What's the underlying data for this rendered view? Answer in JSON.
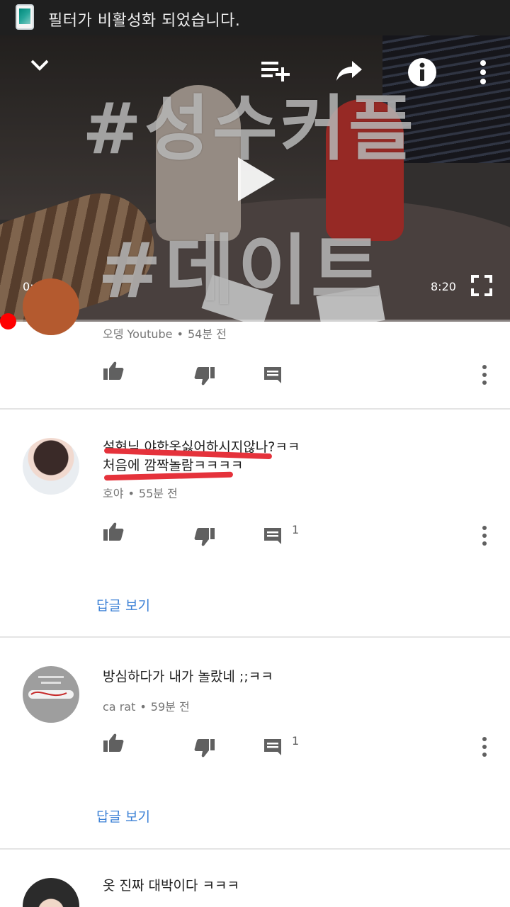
{
  "status_bar": {
    "app_icon": "phone-app-icon",
    "notification_text": "필터가 비활성화 되었습니다."
  },
  "player": {
    "overlay_title_line1": "#성수커플",
    "overlay_title_line2": "#데이트",
    "current_time": "0:04",
    "duration": "8:20",
    "progress_fraction": 0.008,
    "icons": [
      "chevron-down-icon",
      "add-to-playlist-icon",
      "share-icon",
      "info-icon",
      "more-vert-icon",
      "play-icon",
      "fullscreen-icon"
    ]
  },
  "comments": [
    {
      "author": "오뎅 Youtube",
      "time": "54분 전",
      "text": "",
      "reply_count": "",
      "view_replies": ""
    },
    {
      "author": "호야",
      "time": "55분 전",
      "text_line1": "설현님 야한옷싫어하시지않나?ㅋㅋ",
      "text_line2": "처음에 깜짝놀람ㅋㅋㅋㅋ",
      "reply_count": "1",
      "view_replies": "답글 보기"
    },
    {
      "author": "ca rat",
      "time": "59분 전",
      "text": "방심하다가 내가 놀랐네 ;;ㅋㅋ",
      "reply_count": "1",
      "view_replies": "답글 보기"
    },
    {
      "author": "",
      "time": "",
      "text": "옷 진짜 대박이다 ㅋㅋㅋ"
    }
  ],
  "colors": {
    "status_bar_bg": "#1f1f1f",
    "progress_red": "#ff0000",
    "link_blue": "#3e82d6",
    "highlight_red": "#e5323b"
  }
}
